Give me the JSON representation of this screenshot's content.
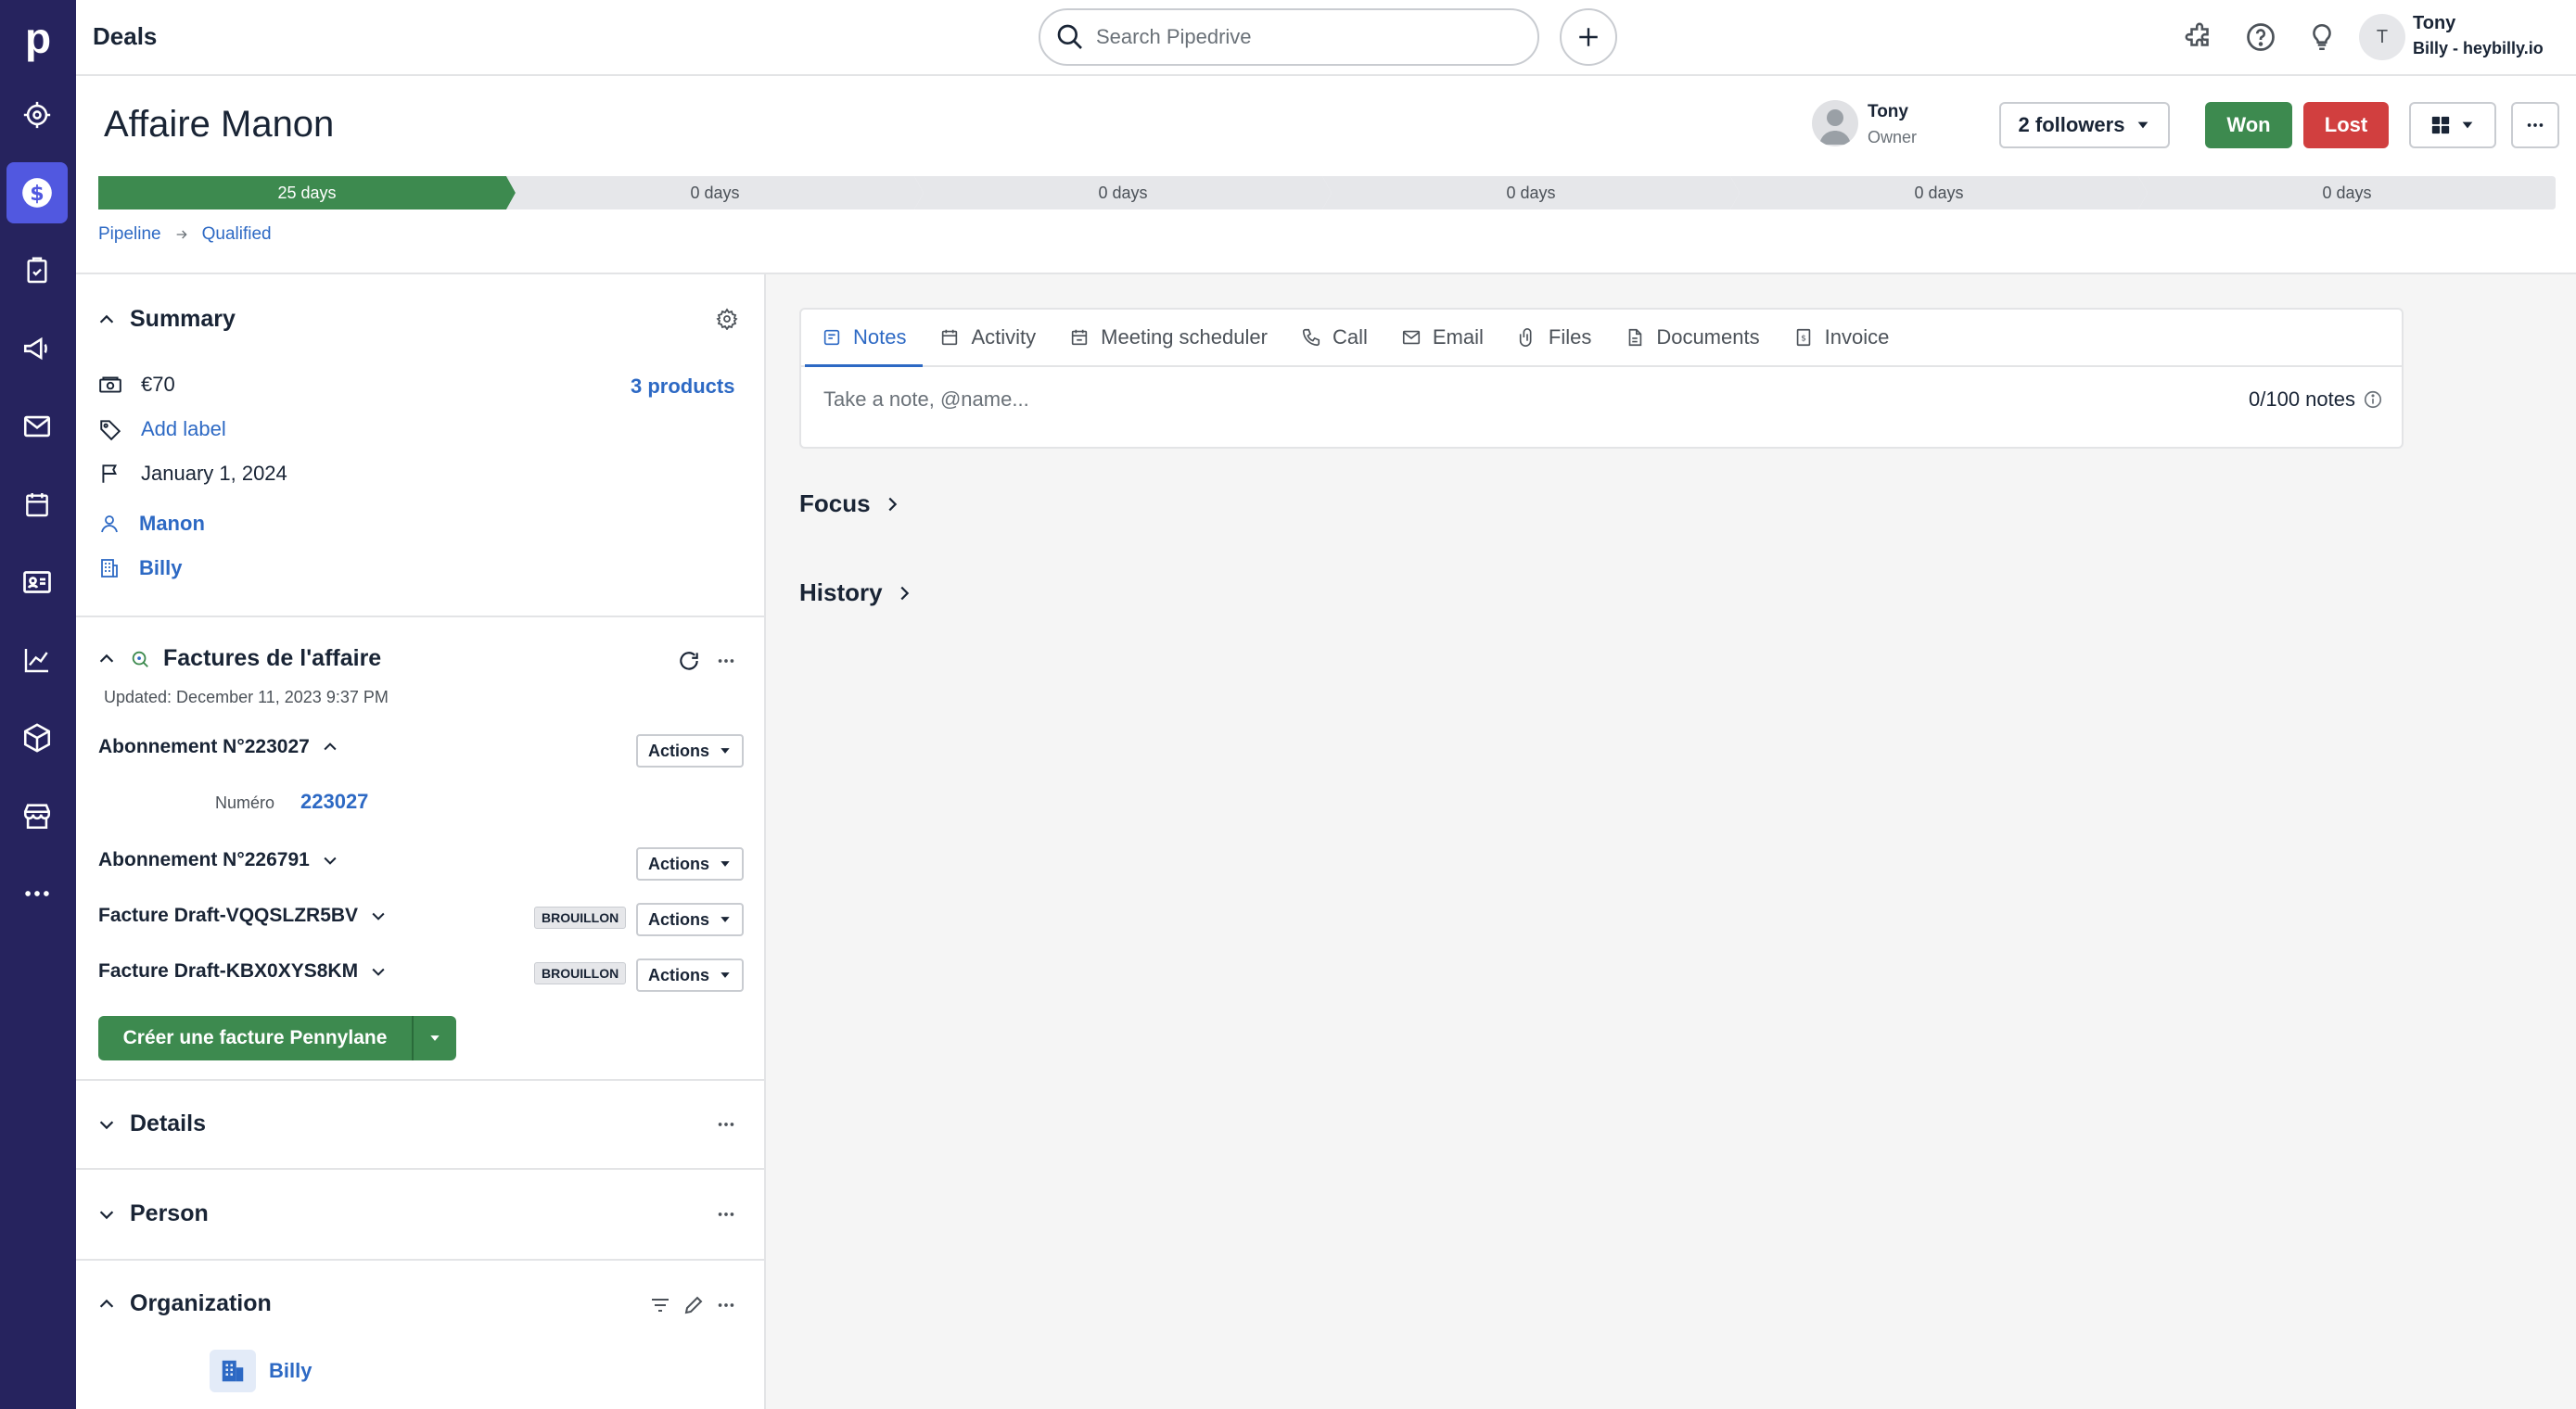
{
  "nav": {
    "logo": "p"
  },
  "topbar": {
    "title": "Deals",
    "search_placeholder": "Search Pipedrive",
    "avatar_initial": "T",
    "user_name": "Tony",
    "user_company": "Billy - heybilly.io"
  },
  "deal": {
    "title": "Affaire Manon",
    "owner_name": "Tony",
    "owner_role": "Owner",
    "followers_label": "2 followers",
    "won_label": "Won",
    "lost_label": "Lost",
    "stages": [
      {
        "label": "25 days",
        "done": true
      },
      {
        "label": "0 days",
        "done": false
      },
      {
        "label": "0 days",
        "done": false
      },
      {
        "label": "0 days",
        "done": false
      },
      {
        "label": "0 days",
        "done": false
      },
      {
        "label": "0 days",
        "done": false
      }
    ],
    "breadcrumb": {
      "pipeline": "Pipeline",
      "stage": "Qualified"
    }
  },
  "summary": {
    "title": "Summary",
    "value": "€70",
    "products": "3 products",
    "add_label": "Add label",
    "date": "January 1, 2024",
    "person": "Manon",
    "org": "Billy"
  },
  "factures": {
    "title": "Factures de l'affaire",
    "updated": "Updated: December 11, 2023 9:37 PM",
    "items": [
      {
        "name": "Abonnement N°223027",
        "actions": "Actions",
        "badge": ""
      },
      {
        "name": "Abonnement N°226791",
        "actions": "Actions",
        "badge": ""
      },
      {
        "name": "Facture Draft-VQQSLZR5BV",
        "actions": "Actions",
        "badge": "BROUILLON"
      },
      {
        "name": "Facture Draft-KBX0XYS8KM",
        "actions": "Actions",
        "badge": "BROUILLON"
      }
    ],
    "numero_label": "Numéro",
    "numero_value": "223027",
    "create_label": "Créer une facture Pennylane"
  },
  "details": {
    "title": "Details"
  },
  "person_section": {
    "title": "Person"
  },
  "organization": {
    "title": "Organization",
    "name": "Billy"
  },
  "composer": {
    "tabs": [
      "Notes",
      "Activity",
      "Meeting scheduler",
      "Call",
      "Email",
      "Files",
      "Documents",
      "Invoice"
    ],
    "placeholder": "Take a note, @name...",
    "count": "0/100 notes"
  },
  "focus": {
    "title": "Focus"
  },
  "history": {
    "title": "History"
  },
  "colors": {
    "nav_bg": "#26235e",
    "nav_active": "#5158e0",
    "link": "#2d69c4",
    "won": "#3d8a4f",
    "lost": "#d13f3f",
    "stage_done": "#3d8a4f"
  }
}
